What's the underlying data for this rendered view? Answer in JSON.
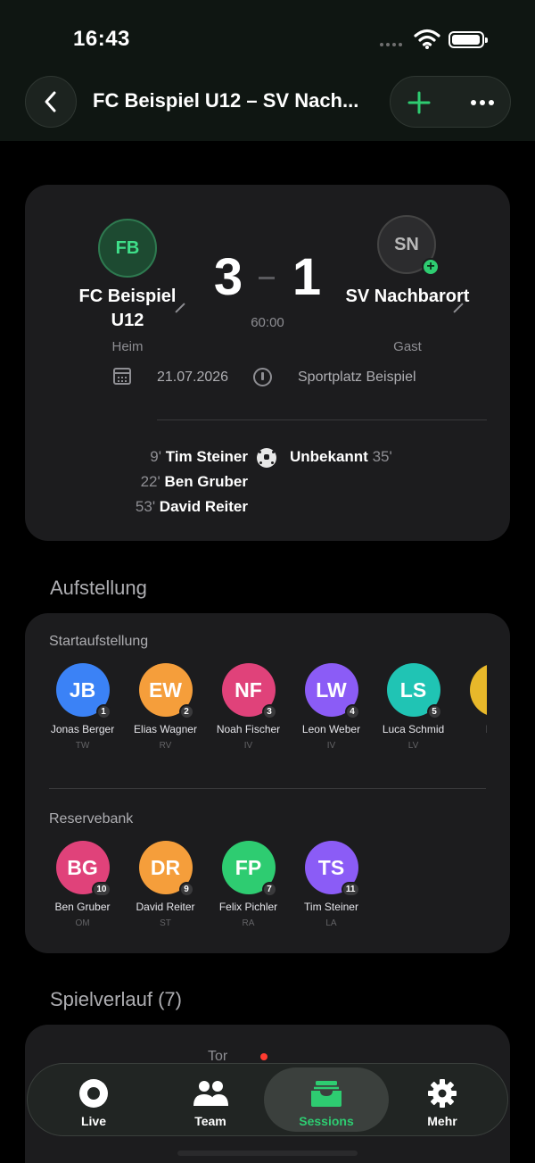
{
  "status_bar": {
    "time": "16:43"
  },
  "header": {
    "title": "FC Beispiel U12 – SV Nach..."
  },
  "match": {
    "home": {
      "initials": "FB",
      "name": "FC Beispiel U12",
      "role": "Heim",
      "score": "3"
    },
    "away": {
      "initials": "SN",
      "name": "SV Nachbarort",
      "role": "Gast",
      "score": "1"
    },
    "clock": "60:00",
    "date": "21.07.2026",
    "venue": "Sportplatz Beispiel",
    "home_goals": [
      {
        "minute": "9'",
        "scorer": "Tim Steiner"
      },
      {
        "minute": "22'",
        "scorer": "Ben Gruber"
      },
      {
        "minute": "53'",
        "scorer": "David Reiter"
      }
    ],
    "away_goals": [
      {
        "minute": "35'",
        "scorer": "Unbekannt"
      }
    ]
  },
  "lineup": {
    "section_title": "Aufstellung",
    "starting_title": "Startaufstellung",
    "starting": [
      {
        "initials": "JB",
        "number": "1",
        "name": "Jonas Berger",
        "pos": "TW",
        "color": "#3b82f6"
      },
      {
        "initials": "EW",
        "number": "2",
        "name": "Elias Wagner",
        "pos": "RV",
        "color": "#f59e3b"
      },
      {
        "initials": "NF",
        "number": "3",
        "name": "Noah Fischer",
        "pos": "IV",
        "color": "#e0427a"
      },
      {
        "initials": "LW",
        "number": "4",
        "name": "Leon Weber",
        "pos": "IV",
        "color": "#8b5cf6"
      },
      {
        "initials": "LS",
        "number": "5",
        "name": "Luca Schmid",
        "pos": "LV",
        "color": "#20c4b4"
      },
      {
        "initials": "FI",
        "number": "",
        "name": "Finn",
        "pos": "",
        "color": "#e8b82a"
      }
    ],
    "bench_title": "Reservebank",
    "bench": [
      {
        "initials": "BG",
        "number": "10",
        "name": "Ben Gruber",
        "pos": "OM",
        "color": "#e0427a"
      },
      {
        "initials": "DR",
        "number": "9",
        "name": "David Reiter",
        "pos": "ST",
        "color": "#f59e3b"
      },
      {
        "initials": "FP",
        "number": "7",
        "name": "Felix Pichler",
        "pos": "RA",
        "color": "#2ecc71"
      },
      {
        "initials": "TS",
        "number": "11",
        "name": "Tim Steiner",
        "pos": "LA",
        "color": "#8b5cf6"
      }
    ]
  },
  "timeline": {
    "section_title": "Spielverlauf (7)",
    "first_event": "Tor"
  },
  "tabbar": {
    "tabs": [
      {
        "label": "Live",
        "icon": "live-icon",
        "active": false
      },
      {
        "label": "Team",
        "icon": "team-icon",
        "active": false
      },
      {
        "label": "Sessions",
        "icon": "tray-icon",
        "active": true
      },
      {
        "label": "Mehr",
        "icon": "gear-icon",
        "active": false
      }
    ]
  },
  "colors": {
    "accent": "#2ecc71",
    "background": "#000000",
    "card": "#1c1c1e"
  }
}
